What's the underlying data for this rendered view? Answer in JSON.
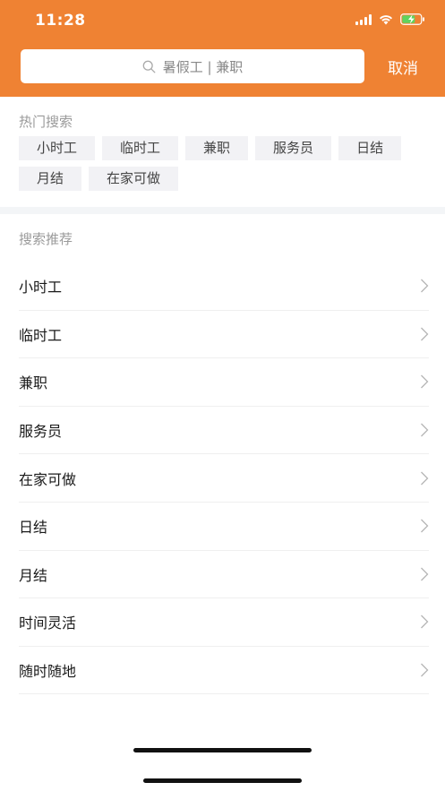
{
  "status_bar": {
    "time": "11:28"
  },
  "search": {
    "placeholder": "暑假工 | 兼职",
    "cancel_label": "取消"
  },
  "hot_search": {
    "title": "热门搜索",
    "tags": [
      "小时工",
      "临时工",
      "兼职",
      "服务员",
      "日结",
      "月结",
      "在家可做"
    ]
  },
  "recommend": {
    "title": "搜索推荐",
    "items": [
      "小时工",
      "临时工",
      "兼职",
      "服务员",
      "在家可做",
      "日结",
      "月结",
      "时间灵活",
      "随时随地"
    ]
  },
  "icons": {
    "search": "search-icon",
    "chevron": "chevron-right-icon",
    "wifi": "wifi-icon",
    "battery": "battery-charging-icon",
    "signal": "signal-icon"
  },
  "colors": {
    "brand": "#ef8233",
    "tag_bg": "#f2f2f5",
    "muted_text": "#9a9a9a"
  }
}
